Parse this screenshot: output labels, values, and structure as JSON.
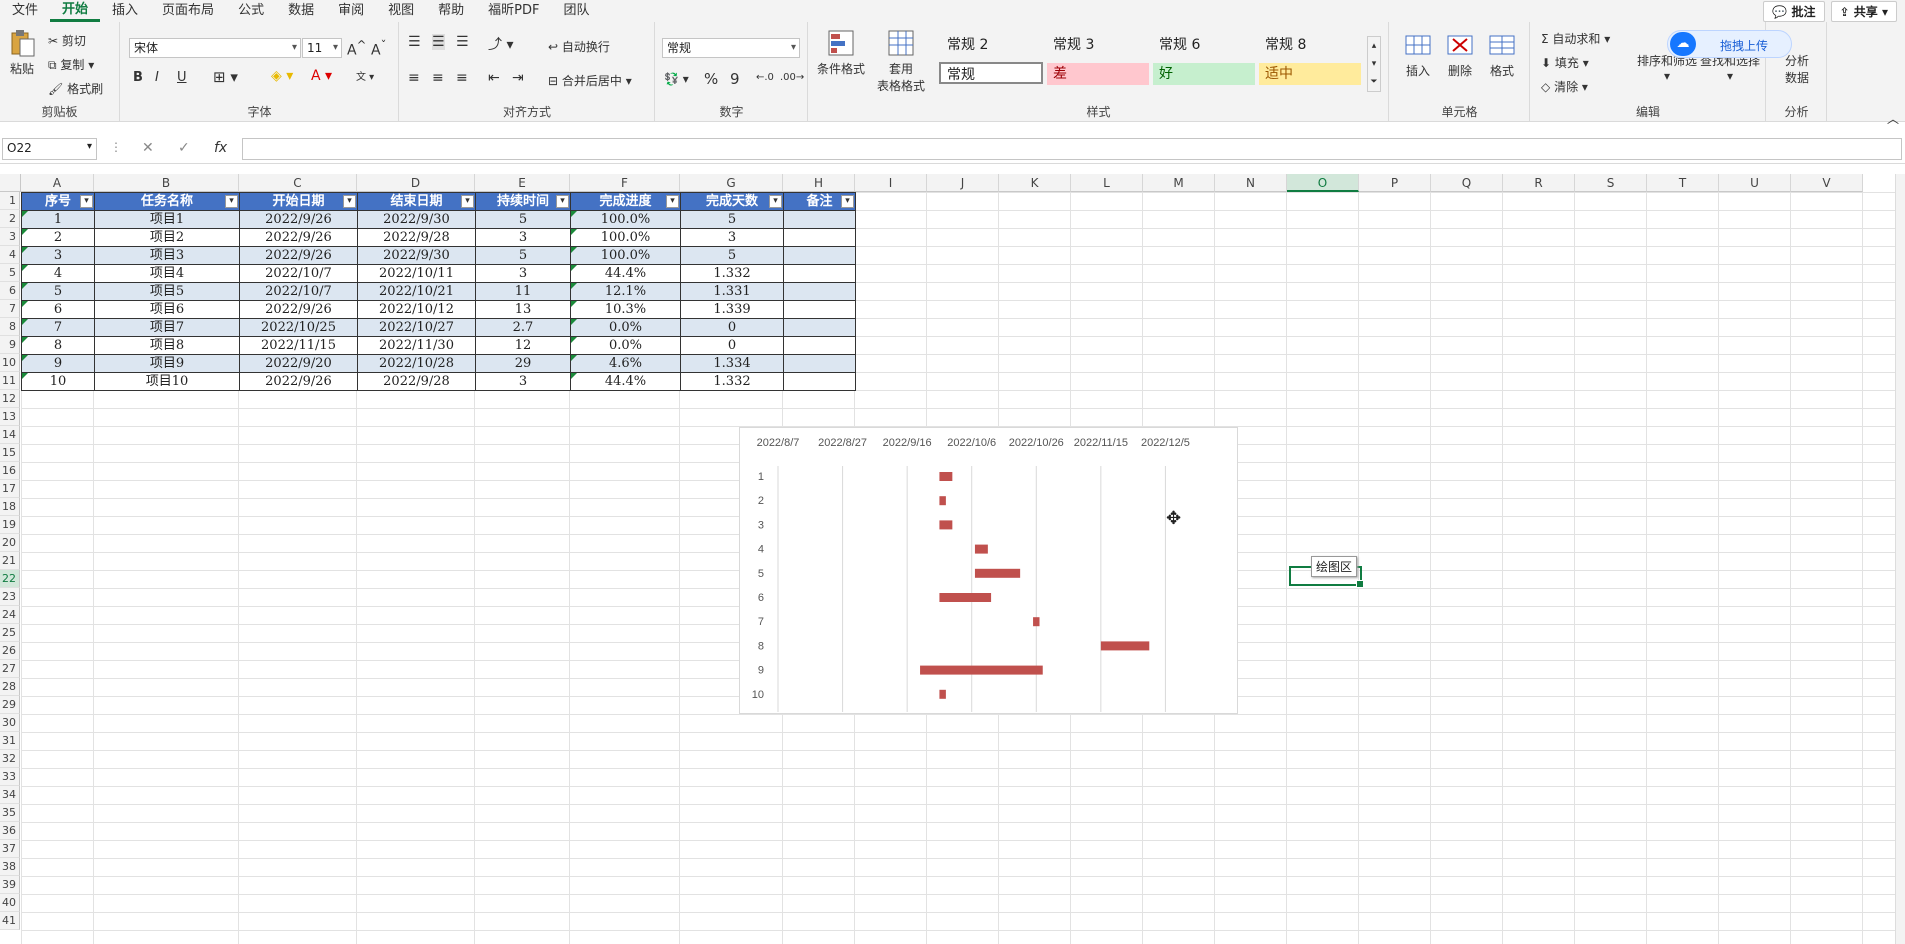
{
  "tabs": [
    "文件",
    "开始",
    "插入",
    "页面布局",
    "公式",
    "数据",
    "审阅",
    "视图",
    "帮助",
    "福昕PDF",
    "团队"
  ],
  "active_tab": "开始",
  "tab_right": {
    "comment": "批注",
    "share": "共享"
  },
  "ribbon": {
    "clipboard": {
      "paste": "粘贴",
      "cut": "剪切",
      "copy": "复制",
      "format_painter": "格式刷",
      "label": "剪贴板"
    },
    "font": {
      "name": "宋体",
      "size": "11",
      "bold": "B",
      "italic": "I",
      "underline": "U",
      "label": "字体"
    },
    "align": {
      "wrap": "自动换行",
      "merge": "合并后居中",
      "label": "对齐方式"
    },
    "number": {
      "format": "常规",
      "percent": "%",
      "comma": "9",
      "label": "数字"
    },
    "styles": {
      "cond": "条件格式",
      "table": "套用",
      "table2": "表格格式",
      "s1": "常规 2",
      "s2": "常规 3",
      "s3": "常规 6",
      "s4": "常规 8",
      "normal": "常规",
      "bad": "差",
      "good": "好",
      "neutral": "适中",
      "label": "样式"
    },
    "cells": {
      "insert": "插入",
      "delete": "删除",
      "format": "格式",
      "label": "单元格"
    },
    "edit": {
      "autosum": "自动求和",
      "fill": "填充",
      "clear": "清除",
      "sort": "排序和筛选",
      "find": "查找和选择",
      "label": "编辑"
    },
    "analysis": {
      "btn": "分析",
      "btn2": "数据",
      "label": "分析"
    },
    "upload": "拖拽上传"
  },
  "formula_bar": {
    "name_box": "O22",
    "fx": "fx",
    "cancel": "✕",
    "enter": "✓",
    "value": ""
  },
  "columns": [
    "A",
    "B",
    "C",
    "D",
    "E",
    "F",
    "G",
    "H",
    "I",
    "J",
    "K",
    "L",
    "M",
    "N",
    "O",
    "P",
    "Q",
    "R",
    "S",
    "T",
    "U",
    "V"
  ],
  "selected_col": "O",
  "rows": [
    "1",
    "2",
    "3",
    "4",
    "5",
    "6",
    "7",
    "8",
    "9",
    "10",
    "11",
    "12",
    "13",
    "14",
    "15",
    "16",
    "17",
    "18",
    "19",
    "20",
    "21",
    "22",
    "23",
    "24",
    "25",
    "26",
    "27",
    "28",
    "29",
    "30",
    "31",
    "32",
    "33",
    "34",
    "35",
    "36",
    "37",
    "38",
    "39",
    "40",
    "41"
  ],
  "selected_row": "22",
  "table": {
    "headers": [
      "序号",
      "任务名称",
      "开始日期",
      "结束日期",
      "持续时间",
      "完成进度",
      "完成天数",
      "备注"
    ],
    "rows": [
      [
        "1",
        "项目1",
        "2022/9/26",
        "2022/9/30",
        "5",
        "100.0%",
        "5",
        ""
      ],
      [
        "2",
        "项目2",
        "2022/9/26",
        "2022/9/28",
        "3",
        "100.0%",
        "3",
        ""
      ],
      [
        "3",
        "项目3",
        "2022/9/26",
        "2022/9/30",
        "5",
        "100.0%",
        "5",
        ""
      ],
      [
        "4",
        "项目4",
        "2022/10/7",
        "2022/10/11",
        "3",
        "44.4%",
        "1.332",
        ""
      ],
      [
        "5",
        "项目5",
        "2022/10/7",
        "2022/10/21",
        "11",
        "12.1%",
        "1.331",
        ""
      ],
      [
        "6",
        "项目6",
        "2022/9/26",
        "2022/10/12",
        "13",
        "10.3%",
        "1.339",
        ""
      ],
      [
        "7",
        "项目7",
        "2022/10/25",
        "2022/10/27",
        "2.7",
        "0.0%",
        "0",
        ""
      ],
      [
        "8",
        "项目8",
        "2022/11/15",
        "2022/11/30",
        "12",
        "0.0%",
        "0",
        ""
      ],
      [
        "9",
        "项目9",
        "2022/9/20",
        "2022/10/28",
        "29",
        "4.6%",
        "1.334",
        ""
      ],
      [
        "10",
        "项目10",
        "2022/9/26",
        "2022/9/28",
        "3",
        "44.4%",
        "1.332",
        ""
      ]
    ]
  },
  "tooltip": "绘图区",
  "chart_data": {
    "type": "bar",
    "orientation": "horizontal-gantt",
    "x_tick_labels": [
      "2022/8/7",
      "2022/8/27",
      "2022/9/16",
      "2022/10/6",
      "2022/10/26",
      "2022/11/15",
      "2022/12/5"
    ],
    "xlim": [
      "2022/8/7",
      "2022/12/25"
    ],
    "categories": [
      "1",
      "2",
      "3",
      "4",
      "5",
      "6",
      "7",
      "8",
      "9",
      "10"
    ],
    "series": [
      {
        "start": [
          "2022/9/26",
          "2022/9/26",
          "2022/9/26",
          "2022/10/7",
          "2022/10/7",
          "2022/9/26",
          "2022/10/25",
          "2022/11/15",
          "2022/9/20",
          "2022/9/26"
        ],
        "end": [
          "2022/9/30",
          "2022/9/28",
          "2022/9/30",
          "2022/10/11",
          "2022/10/21",
          "2022/10/12",
          "2022/10/27",
          "2022/11/30",
          "2022/10/28",
          "2022/9/28"
        ],
        "color": "#c0504d"
      }
    ],
    "axis_position": "top",
    "grid": "vertical"
  }
}
